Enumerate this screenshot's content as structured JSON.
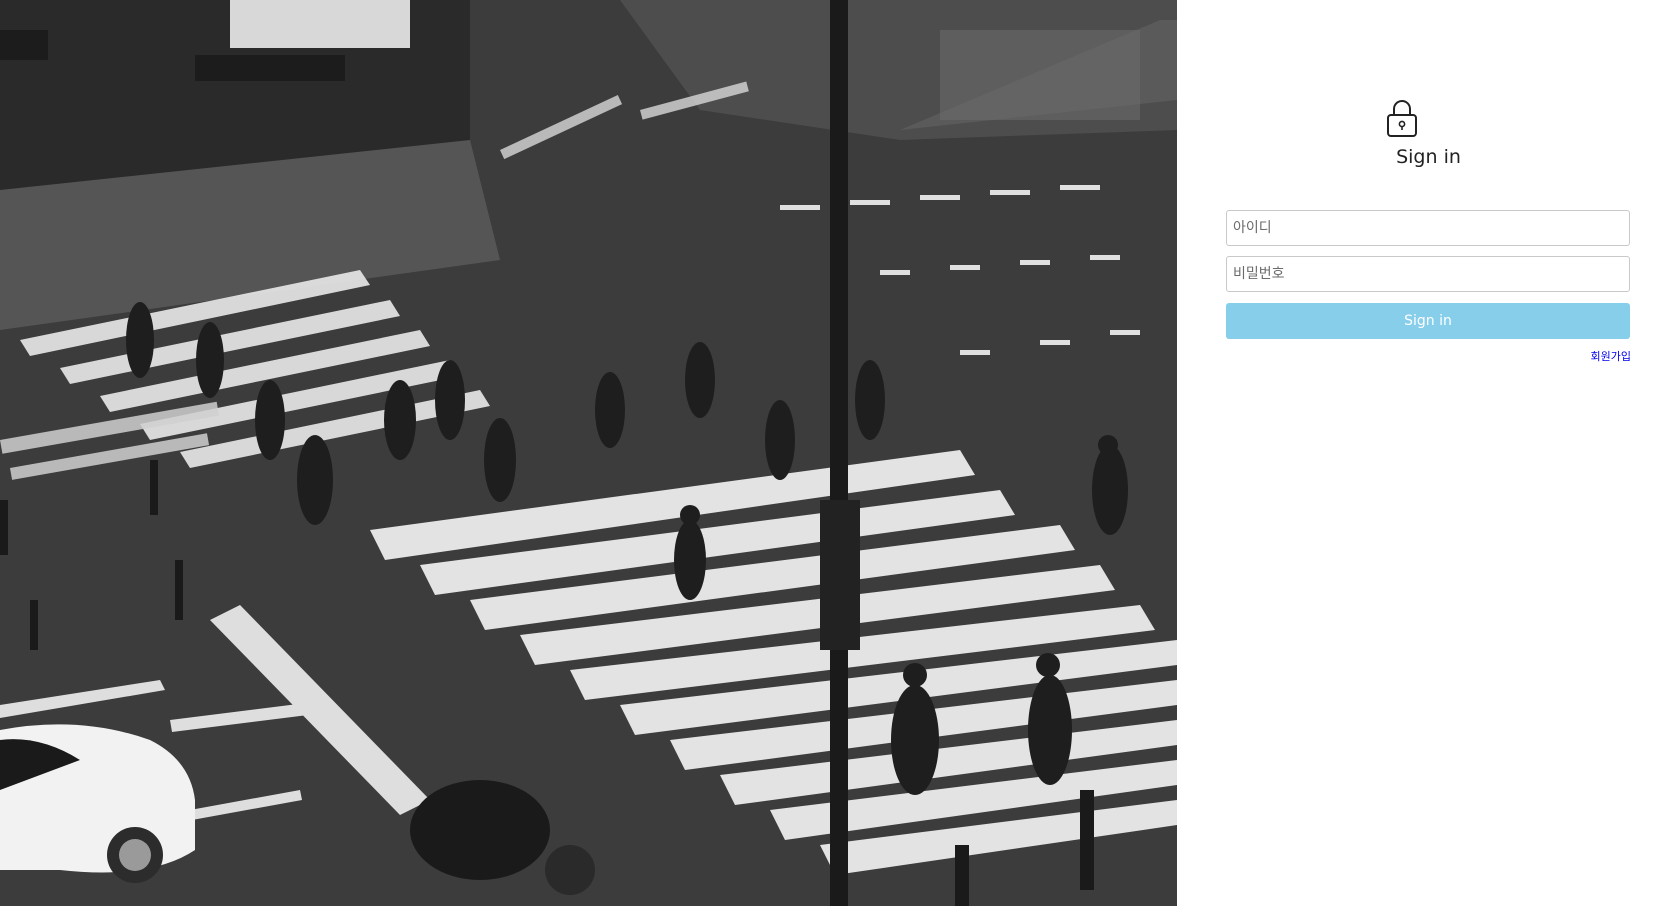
{
  "hero": {
    "icon": "street-crossing-photo"
  },
  "signin": {
    "icon": "lock-icon",
    "title": "Sign in",
    "id_placeholder": "아이디",
    "password_placeholder": "비밀번호",
    "submit_label": "Sign in",
    "signup_link": "회원가입",
    "colors": {
      "button_bg": "#87ceeb",
      "button_text": "#ffffff",
      "link": "#0000ee"
    }
  }
}
